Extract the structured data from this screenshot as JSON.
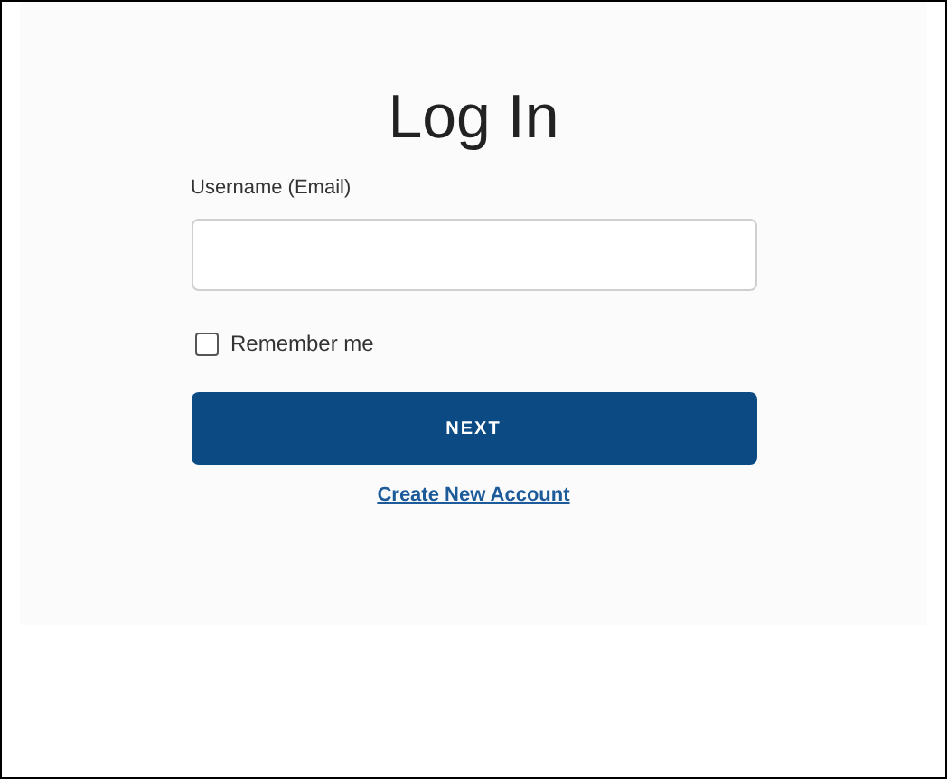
{
  "title": "Log In",
  "username": {
    "label": "Username (Email)"
  },
  "remember": {
    "label": "Remember me",
    "checked": false
  },
  "next_button": "NEXT",
  "create_account_link": "Create New Account"
}
